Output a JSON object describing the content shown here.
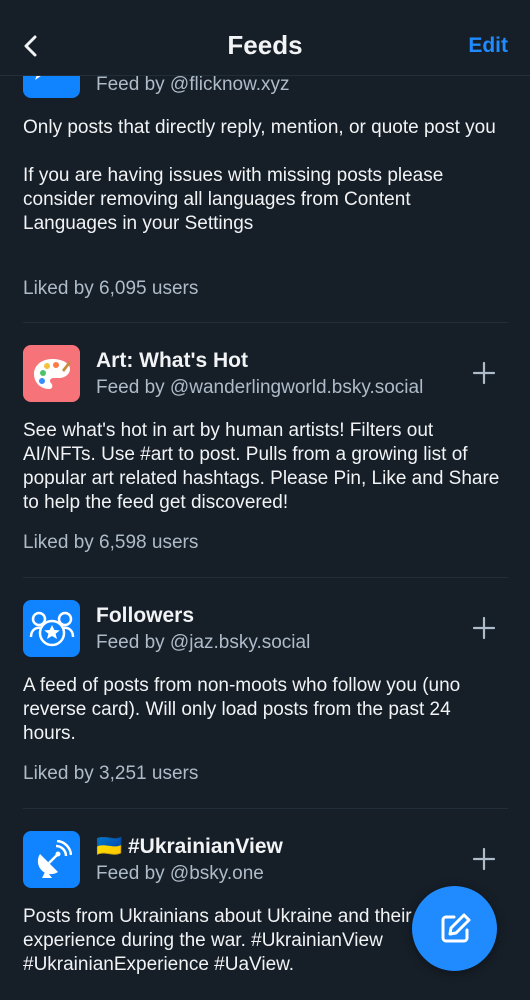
{
  "header": {
    "title": "Feeds",
    "edit_label": "Edit"
  },
  "feeds": [
    {
      "by": "Feed by @flicknow.xyz",
      "description": "Only posts that directly reply, mention, or quote post you\n\nIf you are having issues with missing posts please consider removing all languages from Content Languages in your Settings",
      "likes": "Liked by 6,095 users",
      "avatar_color": "#1083fe"
    },
    {
      "name": "Art: What's Hot",
      "by": "Feed by @wanderlingworld.bsky.social",
      "description": "See what's hot in art by human artists! Filters out AI/NFTs. Use #art to post. Pulls from a growing list of popular art related hashtags. Please Pin, Like and Share to help the feed get discovered!",
      "likes": "Liked by 6,598 users",
      "avatar_color": "#f7737a"
    },
    {
      "name": "Followers",
      "by": "Feed by @jaz.bsky.social",
      "description": "A feed of posts from non-moots who follow you (uno reverse card). Will only load posts from the past 24 hours.",
      "likes": "Liked by 3,251 users",
      "avatar_color": "#1083fe"
    },
    {
      "name": "🇺🇦 #UkrainianView",
      "by": "Feed by @bsky.one",
      "description": "Posts from Ukrainians about Ukraine and their experience during the war. #UkrainianView #UkrainianExperience #UaView.",
      "avatar_color": "#1083fe"
    }
  ],
  "colors": {
    "background": "#161e27",
    "accent": "#208bfe",
    "muted_text": "#aebbc9",
    "divider": "#232e3b"
  }
}
